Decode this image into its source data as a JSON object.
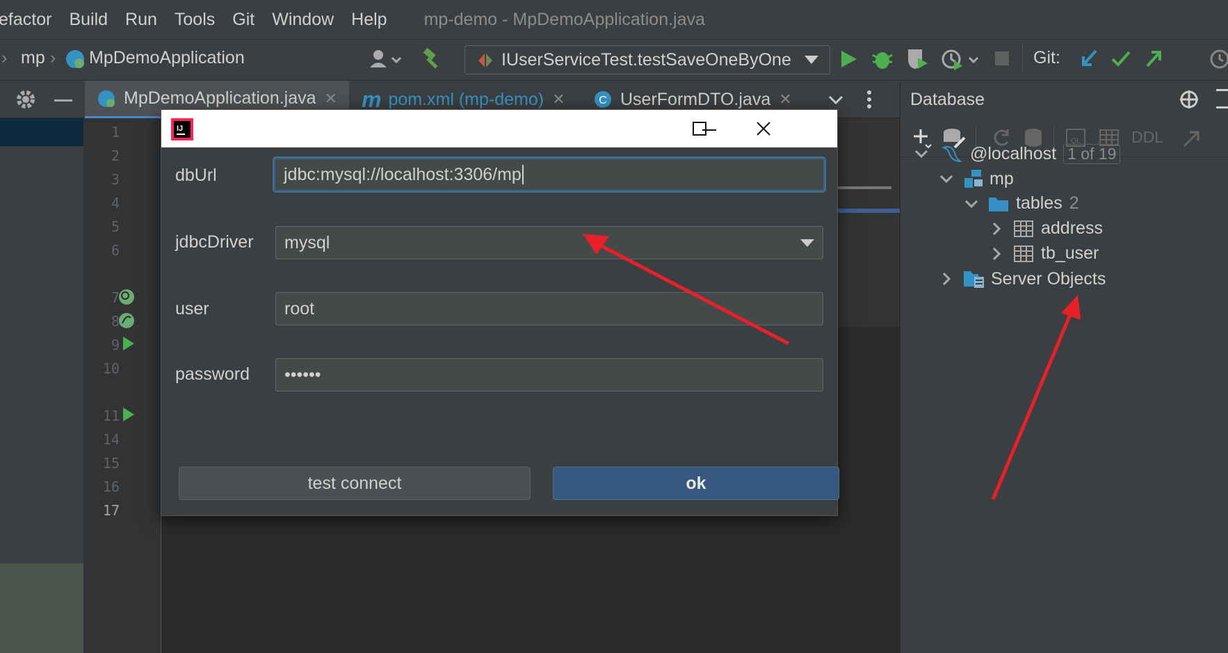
{
  "menu": {
    "items": [
      "efactor",
      "Build",
      "Run",
      "Tools",
      "Git",
      "Window",
      "Help"
    ],
    "window_title": "mp-demo - MpDemoApplication.java"
  },
  "toolbar": {
    "breadcrumb_project": "mp",
    "breadcrumb_class": "MpDemoApplication",
    "run_config": "IUserServiceTest.testSaveOneByOne",
    "git_label": "Git:"
  },
  "tabs": [
    {
      "label": "MpDemoApplication.java",
      "icon": "spring-boot-class-icon"
    },
    {
      "label": "pom.xml (mp-demo)",
      "icon": "maven-icon"
    },
    {
      "label": "UserFormDTO.java",
      "icon": "java-class-icon"
    }
  ],
  "gutter": {
    "line_numbers": [
      "1",
      "2",
      "3",
      "4",
      "5",
      "6",
      "7",
      "8",
      "9",
      "10",
      "11",
      "14",
      "15",
      "16",
      "17"
    ]
  },
  "database": {
    "title": "Database",
    "ddl_label": "DDL",
    "tree": {
      "host": "@localhost",
      "host_badge": "1 of 19",
      "schema": "mp",
      "tables_label": "tables",
      "tables_count": "2",
      "table_1": "address",
      "table_2": "tb_user",
      "server_objects": "Server Objects"
    }
  },
  "dialog": {
    "app_icon": "intellij-idea-icon",
    "fields": {
      "dburl_label": "dbUrl",
      "dburl_value": "jdbc:mysql://localhost:3306/mp",
      "driver_label": "jdbcDriver",
      "driver_value": "mysql",
      "user_label": "user",
      "user_value": "root",
      "password_label": "password",
      "password_value": "••••••"
    },
    "buttons": {
      "test": "test connect",
      "ok": "ok"
    }
  },
  "colors": {
    "accent_blue": "#365880",
    "annotation_red": "#e8202a",
    "run_green": "#4caf50"
  }
}
